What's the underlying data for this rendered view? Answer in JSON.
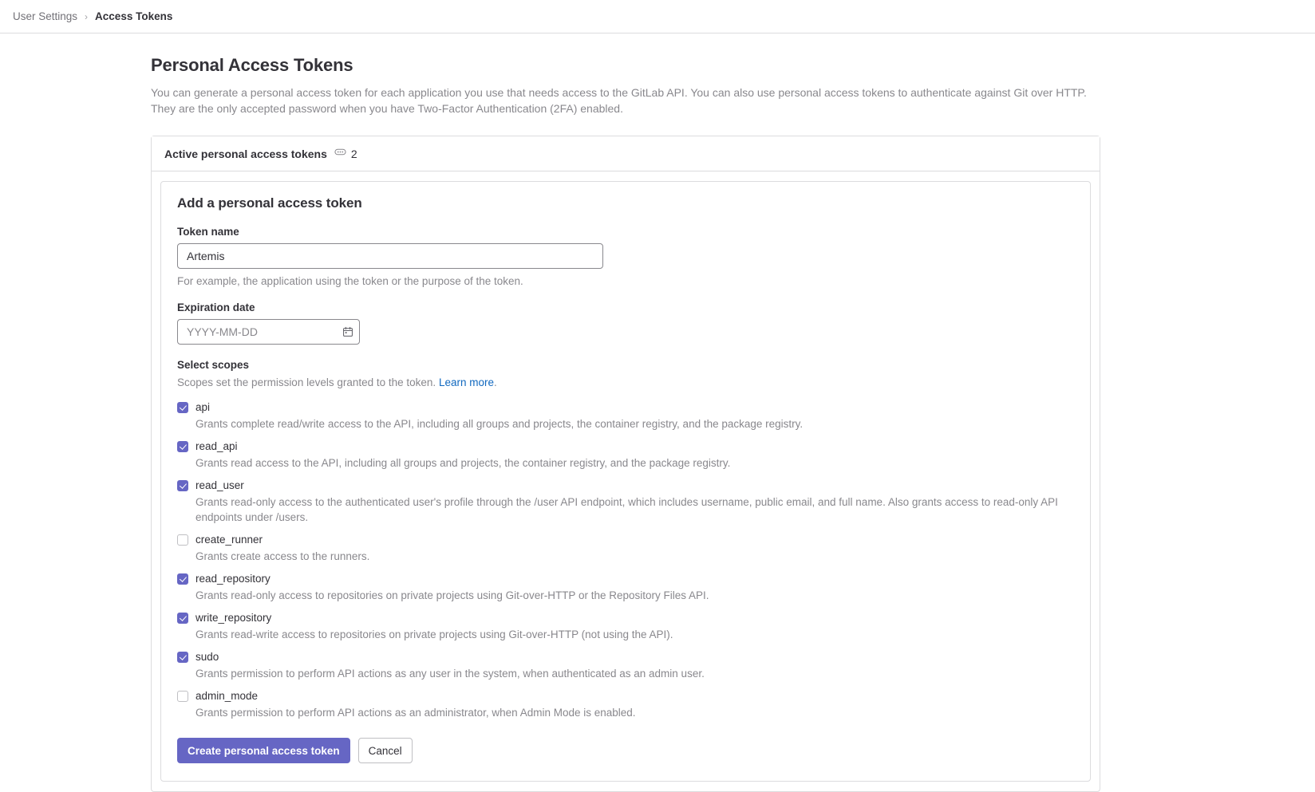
{
  "breadcrumb": {
    "parent": "User Settings",
    "separator": "›",
    "current": "Access Tokens"
  },
  "page": {
    "title": "Personal Access Tokens",
    "description": "You can generate a personal access token for each application you use that needs access to the GitLab API. You can also use personal access tokens to authenticate against Git over HTTP. They are the only accepted password when you have Two-Factor Authentication (2FA) enabled."
  },
  "active_tokens_card": {
    "header_title": "Active personal access tokens",
    "count_icon": "token-pill-icon",
    "count": "2"
  },
  "form": {
    "title": "Add a personal access token",
    "token_name": {
      "label": "Token name",
      "value": "Artemis",
      "placeholder": "",
      "help": "For example, the application using the token or the purpose of the token."
    },
    "expiration_date": {
      "label": "Expiration date",
      "value": "",
      "placeholder": "YYYY-MM-DD",
      "icon": "calendar-icon"
    },
    "scopes": {
      "label": "Select scopes",
      "description": "Scopes set the permission levels granted to the token.",
      "learn_more": "Learn more",
      "description_suffix": ".",
      "items": [
        {
          "name": "api",
          "checked": true,
          "description": "Grants complete read/write access to the API, including all groups and projects, the container registry, and the package registry."
        },
        {
          "name": "read_api",
          "checked": true,
          "description": "Grants read access to the API, including all groups and projects, the container registry, and the package registry."
        },
        {
          "name": "read_user",
          "checked": true,
          "description": "Grants read-only access to the authenticated user's profile through the /user API endpoint, which includes username, public email, and full name. Also grants access to read-only API endpoints under /users."
        },
        {
          "name": "create_runner",
          "checked": false,
          "description": "Grants create access to the runners."
        },
        {
          "name": "read_repository",
          "checked": true,
          "description": "Grants read-only access to repositories on private projects using Git-over-HTTP or the Repository Files API."
        },
        {
          "name": "write_repository",
          "checked": true,
          "description": "Grants read-write access to repositories on private projects using Git-over-HTTP (not using the API)."
        },
        {
          "name": "sudo",
          "checked": true,
          "description": "Grants permission to perform API actions as any user in the system, when authenticated as an admin user."
        },
        {
          "name": "admin_mode",
          "checked": false,
          "description": "Grants permission to perform API actions as an administrator, when Admin Mode is enabled."
        }
      ]
    },
    "actions": {
      "submit_label": "Create personal access token",
      "cancel_label": "Cancel"
    }
  },
  "colors": {
    "accent": "#6666c4",
    "link": "#1068bf",
    "text": "#333238",
    "muted": "#89888d",
    "border": "#dcdcde"
  }
}
